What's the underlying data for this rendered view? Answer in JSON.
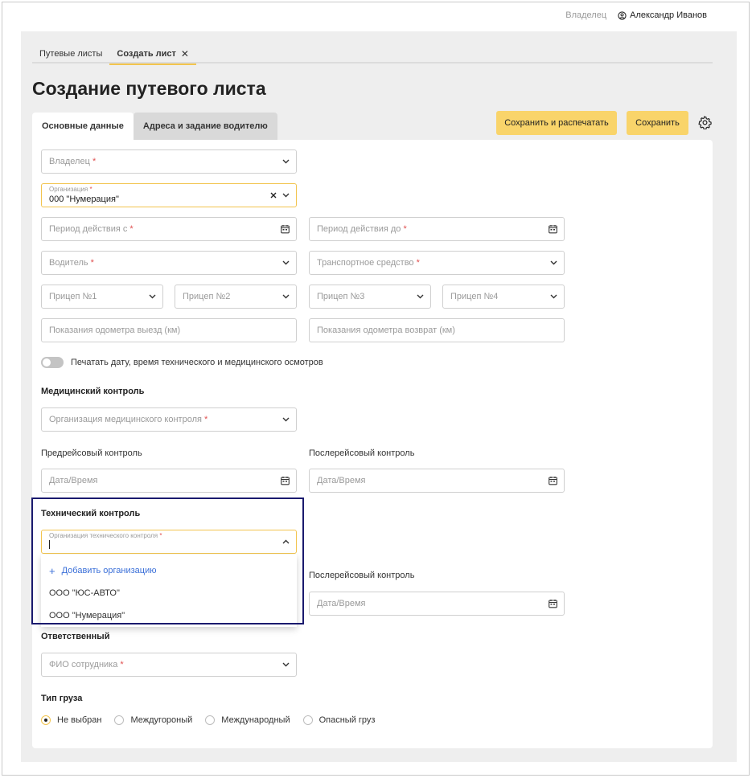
{
  "header": {
    "owner_link": "Владелец",
    "user_name": "Александр Иванов"
  },
  "top_tabs": [
    {
      "label": "Путевые листы"
    },
    {
      "label": "Создать лист"
    }
  ],
  "page_title": "Создание путевого листа",
  "form_tabs": [
    {
      "label": "Основные данные"
    },
    {
      "label": "Адреса и задание водителю"
    }
  ],
  "actions": {
    "save_print": "Сохранить и распечатать",
    "save": "Сохранить"
  },
  "fields": {
    "owner": "Владелец",
    "organization_label": "Организация",
    "organization_value": "000 \"Нумерация\"",
    "period_from": "Период действия с",
    "period_to": "Период действия до",
    "driver": "Водитель",
    "vehicle": "Транспортное средство",
    "trailer1": "Прицеп №1",
    "trailer2": "Прицеп №2",
    "trailer3": "Прицеп №3",
    "trailer4": "Прицеп №4",
    "odometer_out": "Показания одометра выезд (км)",
    "odometer_back": "Показания одометра возврат (км)"
  },
  "toggle_label": "Печатать дату, время технического и медицинского осмотров",
  "medical": {
    "title": "Медицинский контроль",
    "org_placeholder": "Организация медицинского контроля",
    "pre_label": "Предрейсовый контроль",
    "post_label": "Послерейсовый контроль",
    "date_placeholder": "Дата/Время"
  },
  "technical": {
    "title": "Технический контроль",
    "org_label": "Организация технического контроля",
    "post_label": "Послерейсовый контроль",
    "date_placeholder": "Дата/Время",
    "dropdown": {
      "add": "Добавить организацию",
      "options": [
        "ООО \"ЮС-АВТО\"",
        "ООО \"Нумерация\""
      ]
    }
  },
  "responsible": {
    "title": "Ответственный",
    "placeholder": "ФИО сотрудника"
  },
  "cargo": {
    "title": "Тип груза",
    "options": [
      {
        "label": "Не выбран",
        "selected": true
      },
      {
        "label": "Междугороный",
        "selected": false
      },
      {
        "label": "Международный",
        "selected": false
      },
      {
        "label": "Опасный груз",
        "selected": false
      }
    ]
  },
  "required_mark": "*",
  "colors": {
    "accent": "#f9d46a",
    "link": "#3a6fd8",
    "required": "#e05050",
    "highlight_border": "#1a1a6e"
  }
}
